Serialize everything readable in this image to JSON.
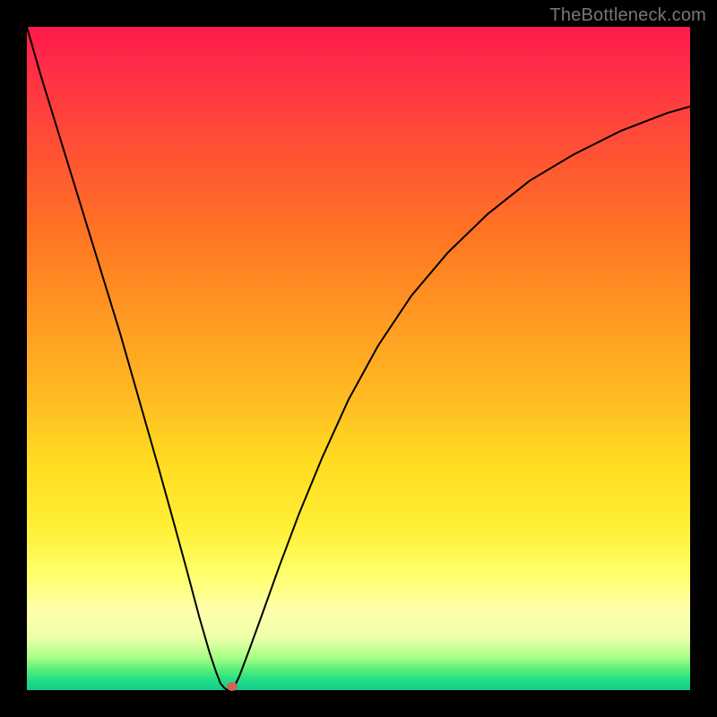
{
  "watermark": "TheBottleneck.com",
  "chart_data": {
    "type": "line",
    "title": "",
    "xlabel": "",
    "ylabel": "",
    "xlim": [
      0,
      1
    ],
    "ylim": [
      0,
      1
    ],
    "grid": false,
    "series": [
      {
        "name": "left-branch",
        "x": [
          0.0,
          0.02,
          0.04,
          0.06,
          0.08,
          0.1,
          0.12,
          0.14,
          0.16,
          0.18,
          0.2,
          0.22,
          0.24,
          0.26,
          0.275,
          0.285,
          0.292,
          0.298,
          0.303
        ],
        "values": [
          1.0,
          0.93,
          0.865,
          0.8,
          0.735,
          0.67,
          0.605,
          0.54,
          0.47,
          0.4,
          0.33,
          0.258,
          0.185,
          0.11,
          0.058,
          0.028,
          0.01,
          0.003,
          0.0
        ]
      },
      {
        "name": "right-branch",
        "x": [
          0.31,
          0.32,
          0.335,
          0.355,
          0.38,
          0.41,
          0.445,
          0.485,
          0.53,
          0.58,
          0.635,
          0.695,
          0.758,
          0.825,
          0.895,
          0.965,
          1.0
        ],
        "values": [
          0.0,
          0.02,
          0.06,
          0.115,
          0.185,
          0.265,
          0.35,
          0.438,
          0.52,
          0.595,
          0.66,
          0.718,
          0.768,
          0.808,
          0.843,
          0.87,
          0.88
        ]
      }
    ],
    "marker": {
      "x": 0.31,
      "y": 0.005
    },
    "curve_color": "#000000",
    "curve_width": 2
  }
}
